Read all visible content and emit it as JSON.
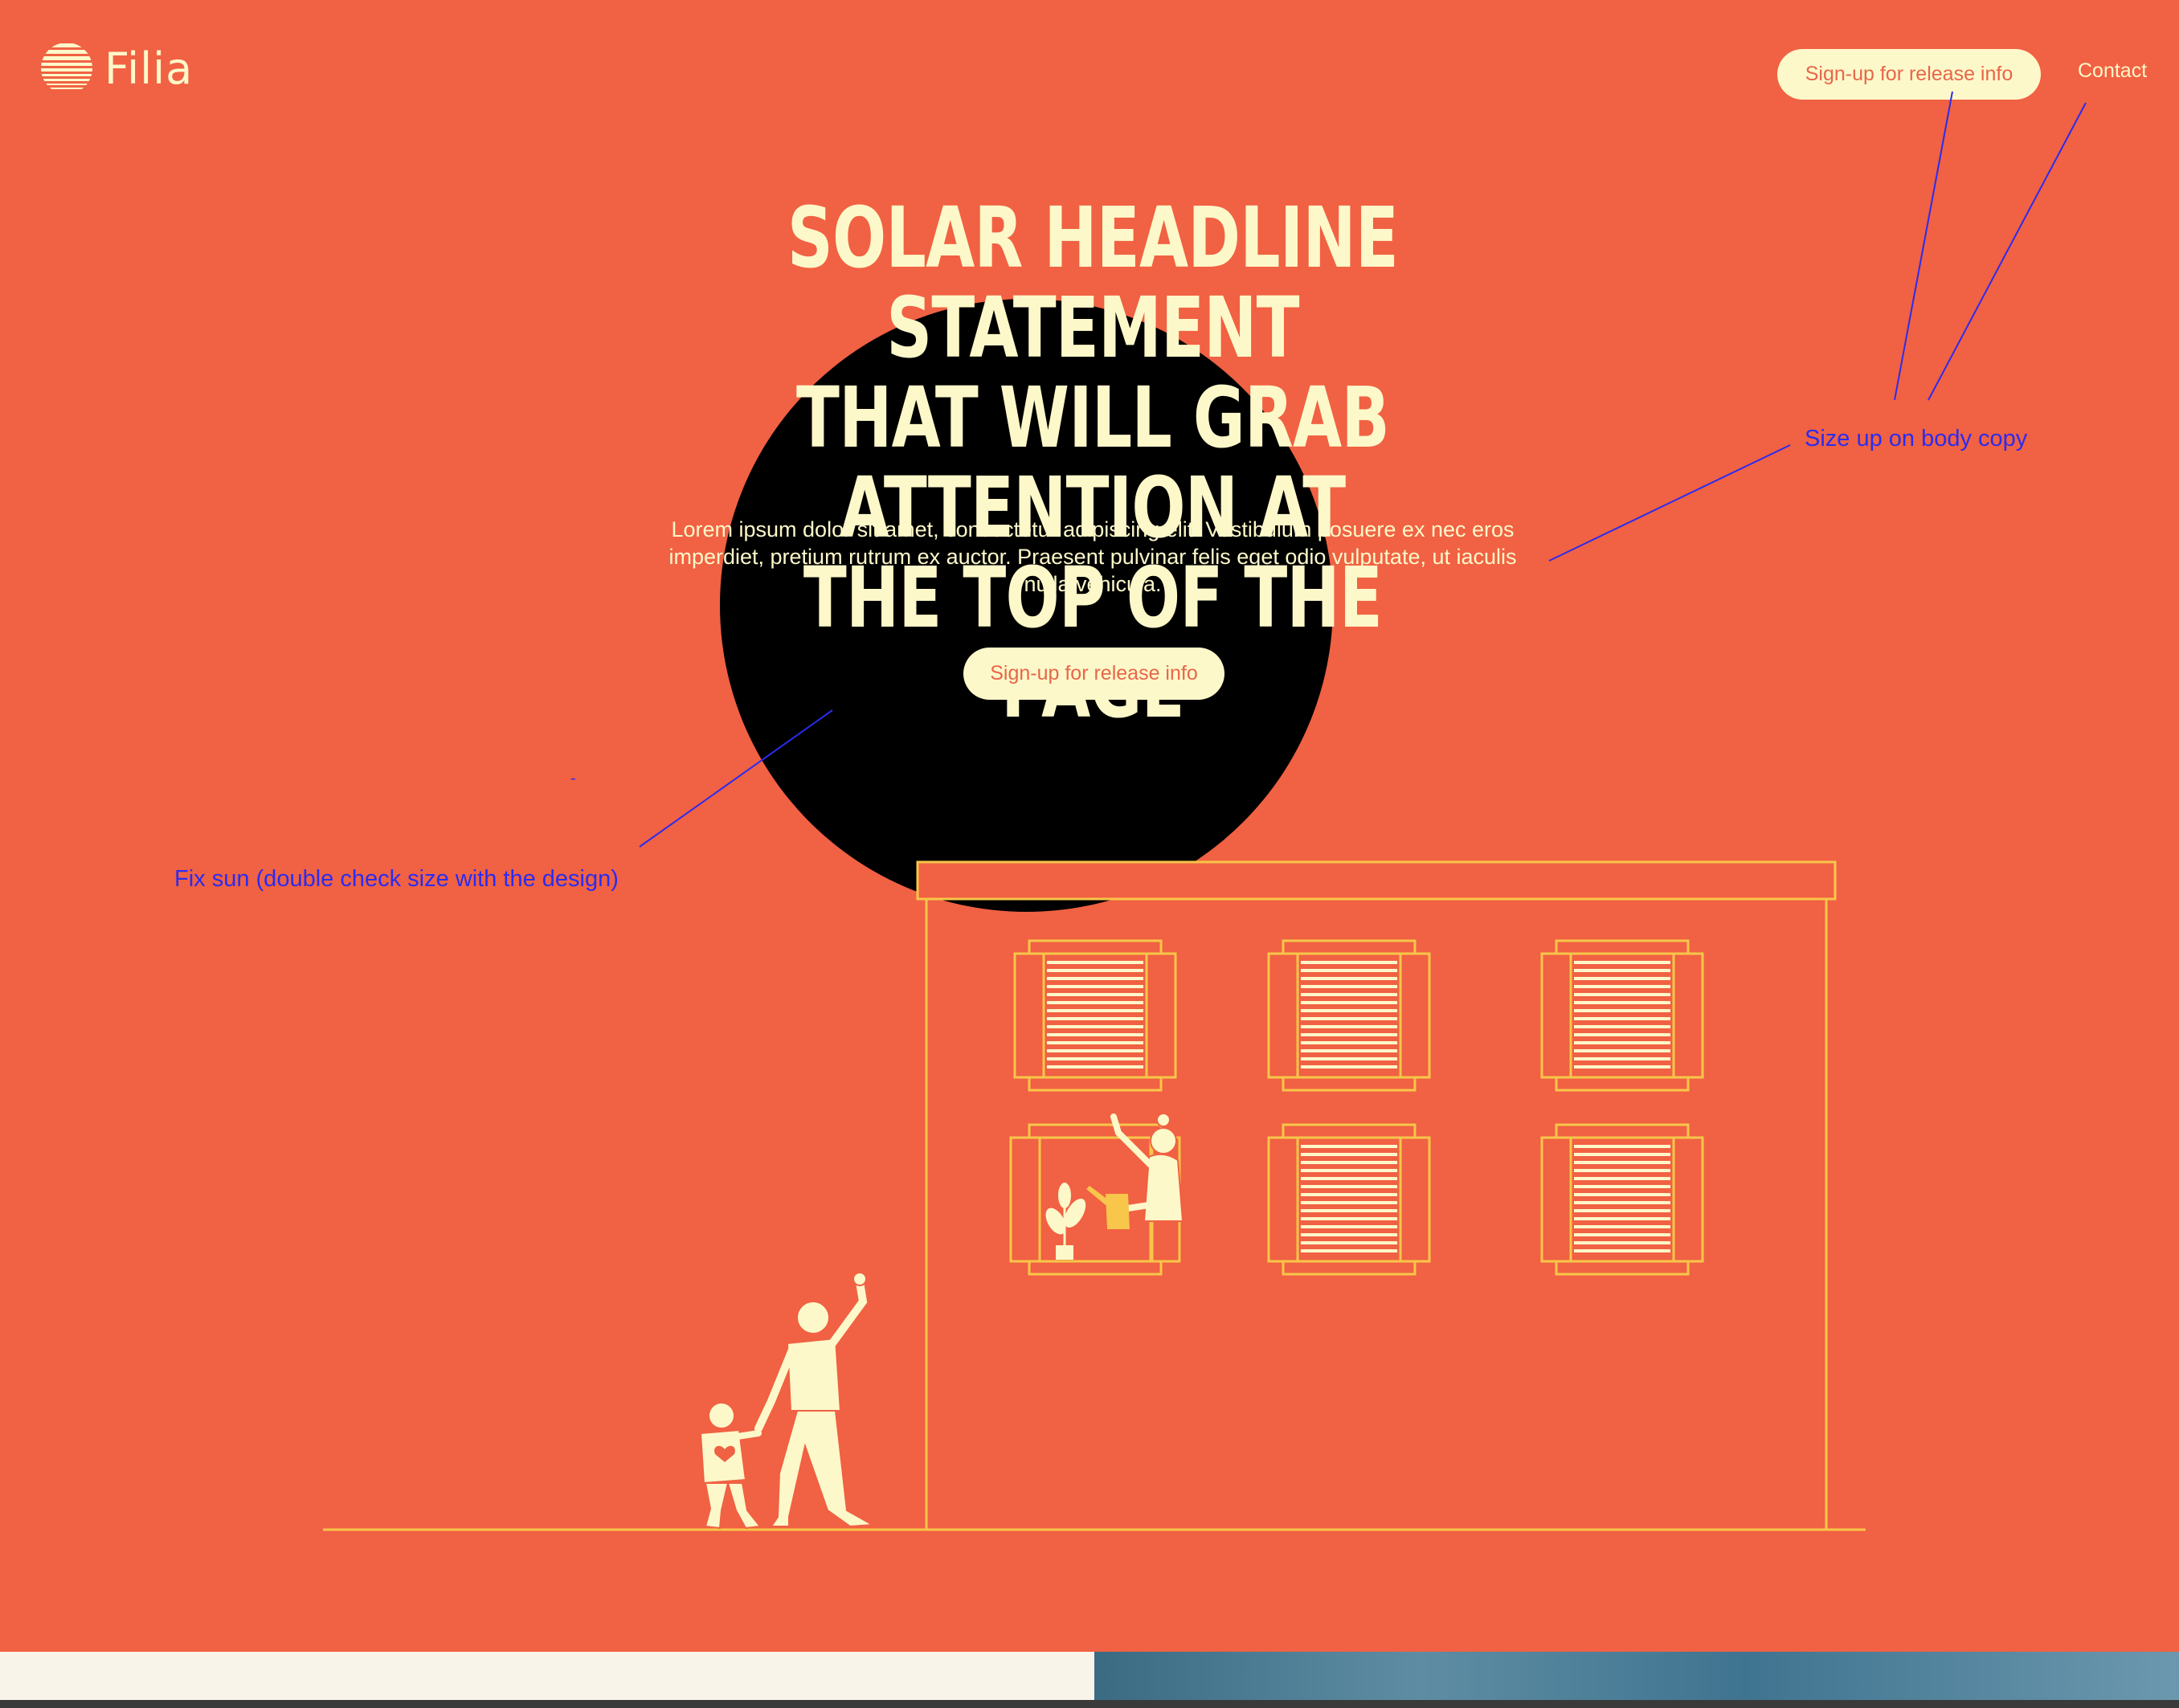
{
  "colors": {
    "background": "#F16143",
    "cream": "#FDF8C9",
    "line": "#F7C64A",
    "sun": "#000000",
    "annotation": "#2A2CF0"
  },
  "header": {
    "logo_text": "Filia",
    "cta_label": "Sign-up for release info",
    "contact_label": "Contact"
  },
  "hero": {
    "headline": [
      "SOLAR HEADLINE STATEMENT",
      "THAT WILL GRAB ATTENTION AT",
      "THE TOP OF THE PAGE"
    ],
    "body": "Lorem ipsum dolor sit amet, consectetur adipiscing elit. Vestibulum posuere ex nec eros imperdiet, pretium rutrum ex auctor. Praesent pulvinar felis eget odio vulputate, ut iaculis nulla vehicula.",
    "cta_label": "Sign-up for release info"
  },
  "annotations": {
    "body_copy_note": "Size up on body copy",
    "sun_note": "Fix sun (double check size with the design)",
    "stray_mark": "-"
  },
  "icons": {
    "logo": "striped-sun-logo-icon"
  }
}
